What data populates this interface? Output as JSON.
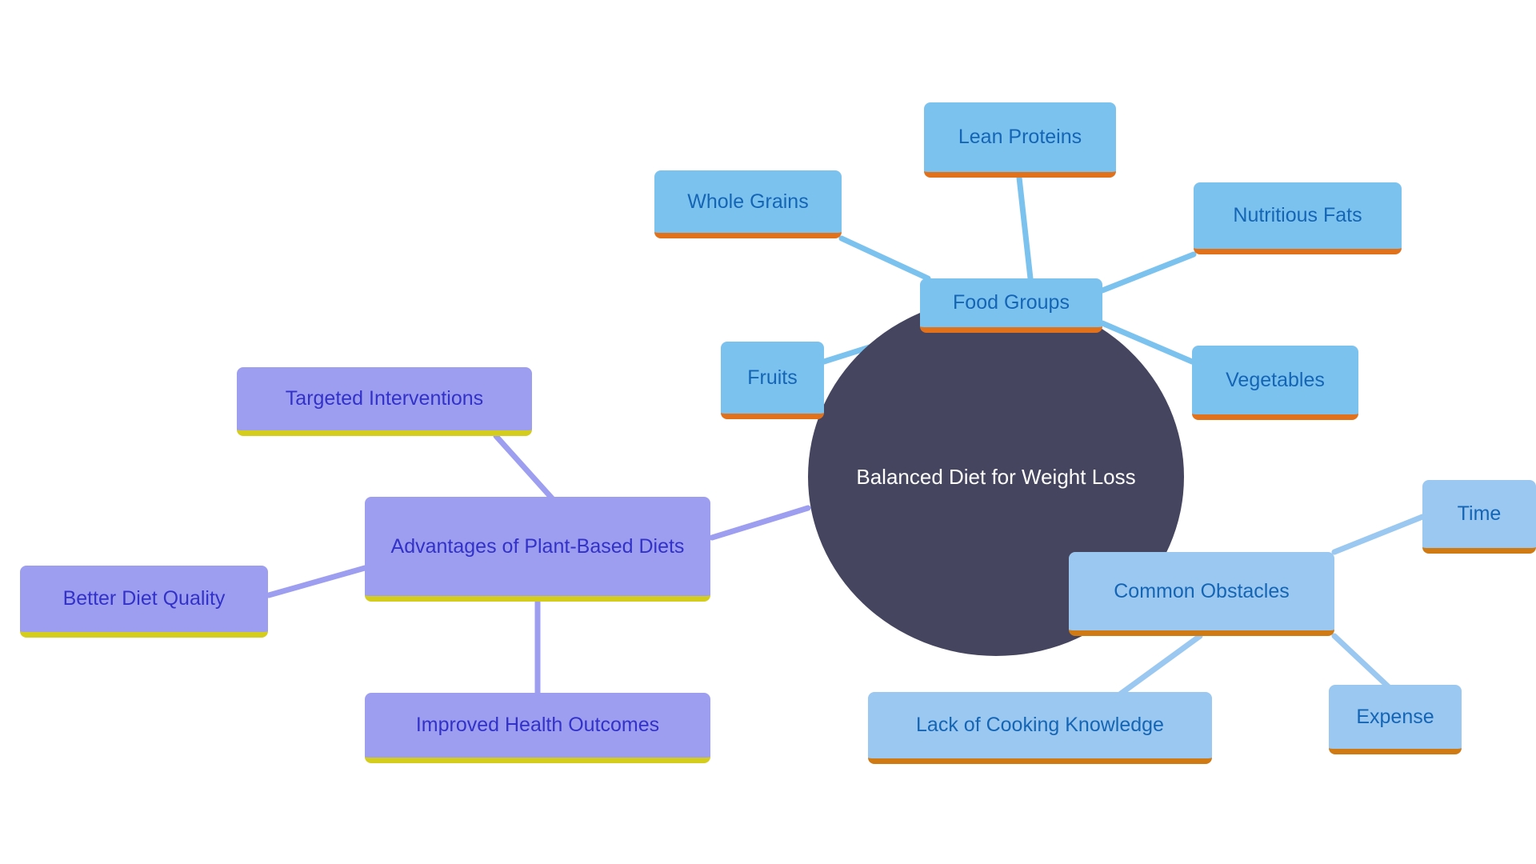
{
  "diagram": {
    "type": "mind-map",
    "title": "Balanced Diet for Weight Loss",
    "background_color": "#ffffff",
    "palette": {
      "central_fill": "#454560",
      "central_text": "#ffffff",
      "blue_fill": "#7cc2ef",
      "blue_text": "#1565b5",
      "blue_underline": "#e2711c",
      "blue_light_fill": "#9bc8f0",
      "blue_light_underline": "#d07a14",
      "purple_fill": "#9e9ef0",
      "purple_text": "#3232c8",
      "purple_underline": "#d4cd1e",
      "edge_blue": "#7cc2ef",
      "edge_purple": "#9e9ef0"
    }
  },
  "central": {
    "label": "Balanced Diet for Weight Loss"
  },
  "branches": [
    {
      "id": "food-groups",
      "label": "Food Groups",
      "color_group": "blue",
      "children": [
        {
          "id": "whole-grains",
          "label": "Whole Grains"
        },
        {
          "id": "lean-proteins",
          "label": "Lean Proteins"
        },
        {
          "id": "nutritious-fats",
          "label": "Nutritious Fats"
        },
        {
          "id": "vegetables",
          "label": "Vegetables"
        },
        {
          "id": "fruits",
          "label": "Fruits"
        }
      ]
    },
    {
      "id": "advantages-plant-based",
      "label": "Advantages of Plant-Based Diets",
      "color_group": "purple",
      "children": [
        {
          "id": "targeted-interventions",
          "label": "Targeted Interventions"
        },
        {
          "id": "better-diet-quality",
          "label": "Better Diet Quality"
        },
        {
          "id": "improved-health-outcomes",
          "label": "Improved Health Outcomes"
        }
      ]
    },
    {
      "id": "common-obstacles",
      "label": "Common Obstacles",
      "color_group": "blue-light",
      "children": [
        {
          "id": "time",
          "label": "Time"
        },
        {
          "id": "expense",
          "label": "Expense"
        },
        {
          "id": "lack-of-cooking-knowledge",
          "label": "Lack of Cooking Knowledge"
        }
      ]
    }
  ],
  "nodes": {
    "lean_proteins": "Lean Proteins",
    "whole_grains": "Whole Grains",
    "nutritious_fats": "Nutritious Fats",
    "food_groups": "Food Groups",
    "fruits": "Fruits",
    "vegetables": "Vegetables",
    "targeted_interventions": "Targeted Interventions",
    "advantages_plant_based": "Advantages of Plant-Based Diets",
    "better_diet_quality": "Better Diet Quality",
    "improved_health_outcomes": "Improved Health Outcomes",
    "common_obstacles": "Common Obstacles",
    "time": "Time",
    "expense": "Expense",
    "lack_of_cooking_knowledge": "Lack of Cooking Knowledge"
  }
}
